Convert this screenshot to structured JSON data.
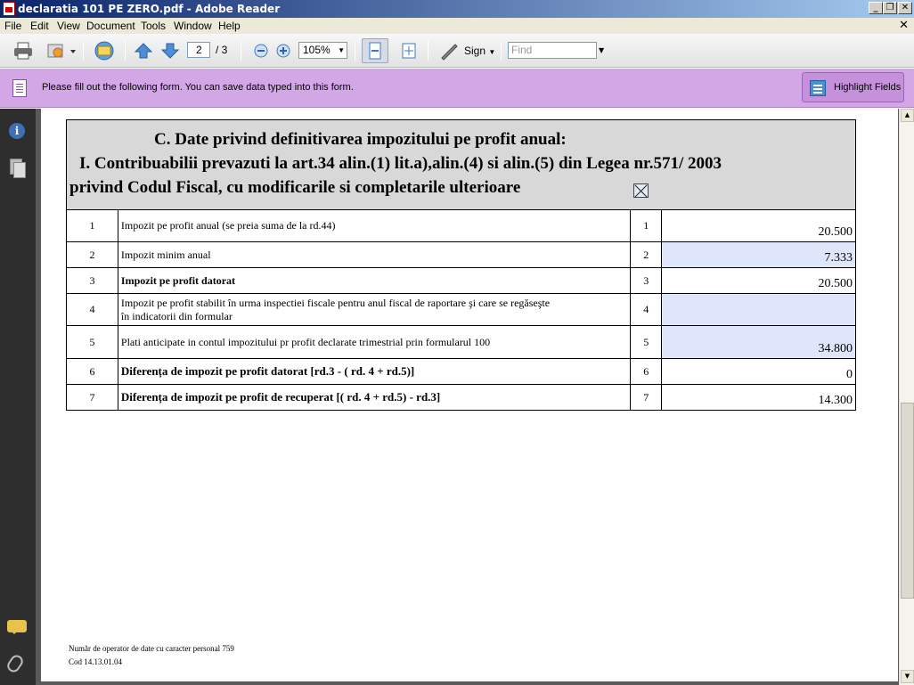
{
  "window": {
    "title": "declaratia 101 PE ZERO.pdf - Adobe Reader",
    "min": "_",
    "max": "❐",
    "close": "✕"
  },
  "menu": {
    "items": [
      "File",
      "Edit",
      "View",
      "Document",
      "Tools",
      "Window",
      "Help"
    ],
    "doc_close": "✕"
  },
  "toolbar": {
    "page_current": "2",
    "page_total": "/ 3",
    "zoom": "105%",
    "sign_label": "Sign",
    "find_placeholder": "Find"
  },
  "form_bar": {
    "message": "Please fill out the following form. You can save data typed into this form.",
    "highlight_label": "Highlight Fields"
  },
  "doc": {
    "header": {
      "line1": "C. Date privind definitivarea impozitului pe profit anual:",
      "line2": "I.  Contribuabilii prevazuti la art.34 alin.(1) lit.a),alin.(4) si alin.(5) din Legea nr.571/ 2003",
      "line3": "privind Codul Fiscal, cu modificarile si completarile ulterioare"
    },
    "rows": [
      {
        "num": "1",
        "desc": "Impozit pe profit anual (se preia suma de la rd.44)",
        "rd": "1",
        "value": "20.500"
      },
      {
        "num": "2",
        "desc": "Impozit minim anual",
        "rd": "2",
        "value": "7.333"
      },
      {
        "num": "3",
        "desc": "Impozit pe profit datorat",
        "rd": "3",
        "value": "20.500"
      },
      {
        "num": "4",
        "desc1": "Impozit pe profit stabilit în urma inspectiei fiscale pentru anul fiscal de raportare şi care se regăseşte",
        "desc2": "în indicatorii din formular",
        "rd": "4",
        "value": ""
      },
      {
        "num": "5",
        "desc": "Plati anticipate in contul impozitului pr profit declarate trimestrial prin formularul 100",
        "rd": "5",
        "value": "34.800"
      },
      {
        "num": "6",
        "desc": "Diferența de impozit pe profit datorat   [rd.3 - ( rd. 4 + rd.5)]",
        "rd": "6",
        "value": "0"
      },
      {
        "num": "7",
        "desc": "Diferența de impozit pe profit de recuperat   [( rd. 4 + rd.5) - rd.3]",
        "rd": "7",
        "value": "14.300"
      }
    ],
    "footer_line1": "Număr de operator de date cu caracter personal 759",
    "footer_line2": "Cod 14.13.01.04"
  },
  "colors": {
    "form_bar": "#d3a7e6",
    "field_highlight": "#dfe5fb",
    "title_bar": "#0a246a"
  }
}
